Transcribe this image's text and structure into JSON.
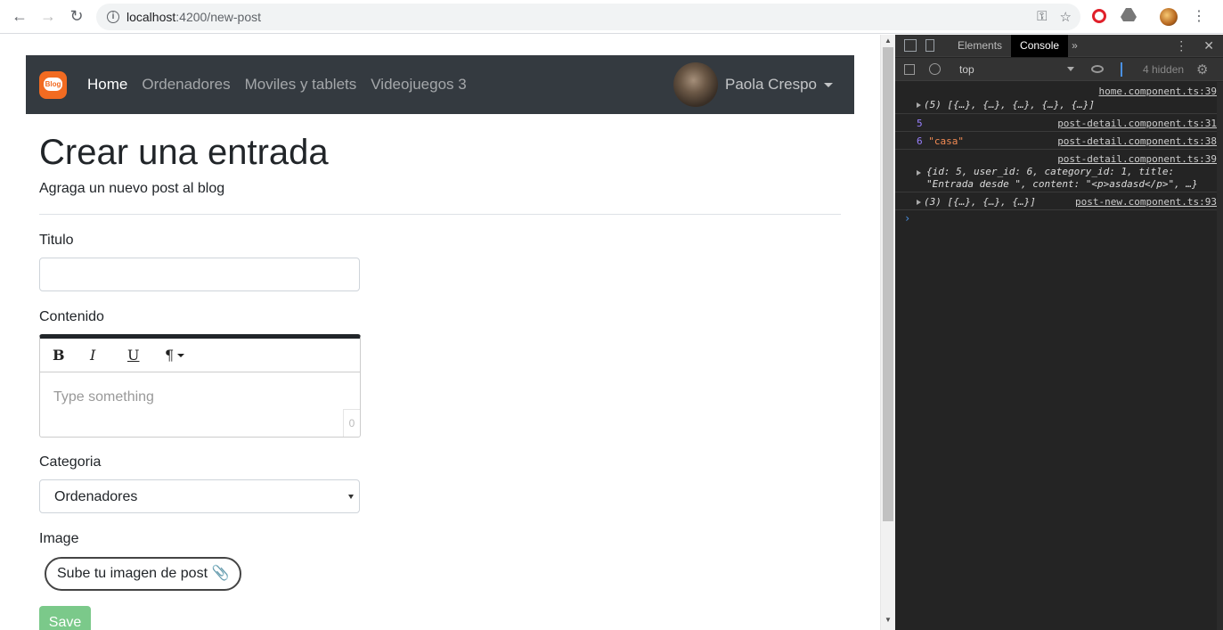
{
  "browser": {
    "url_host": "localhost",
    "url_path": ":4200/new-post"
  },
  "navbar": {
    "brand_text": "Blog",
    "links": [
      "Home",
      "Ordenadores",
      "Moviles y tablets",
      "Videojuegos 3"
    ],
    "active_link": "Home",
    "user_name": "Paola Crespo"
  },
  "page": {
    "title": "Crear una entrada",
    "subtitle": "Agraga un nuevo post al blog",
    "titulo_label": "Titulo",
    "titulo_value": "",
    "contenido_label": "Contenido",
    "editor": {
      "bold": "B",
      "italic": "I",
      "underline": "U",
      "paragraph": "¶",
      "placeholder": "Type something",
      "counter": "0"
    },
    "categoria_label": "Categoria",
    "categoria_selected": "Ordenadores",
    "image_label": "Image",
    "upload_label": "Sube tu imagen de post 📎",
    "save_label": "Save"
  },
  "devtools": {
    "tabs": [
      "Elements",
      "Console"
    ],
    "active_tab": "Console",
    "context": "top",
    "hidden_count": "4 hidden",
    "logs": [
      {
        "source": "home.component.ts:39",
        "text": "(5) [{…}, {…}, {…}, {…}, {…}]"
      },
      {
        "source": "post-detail.component.ts:31",
        "text": "5"
      },
      {
        "source": "post-detail.component.ts:38",
        "prefix": "6",
        "text": "\"casa\""
      },
      {
        "source": "post-detail.component.ts:39",
        "text": "{id: 5, user_id: 6, category_id: 1, title: \"Entrada desde \", content: \"<p>asdasd</p>\", …}"
      },
      {
        "source": "post-new.component.ts:93",
        "text": "(3) [{…}, {…}, {…}]"
      }
    ]
  },
  "colors": {
    "navbar": "#343a40",
    "brand": "#f26b21",
    "save_button": "#7bc98a",
    "devtools_bg": "#242424"
  }
}
